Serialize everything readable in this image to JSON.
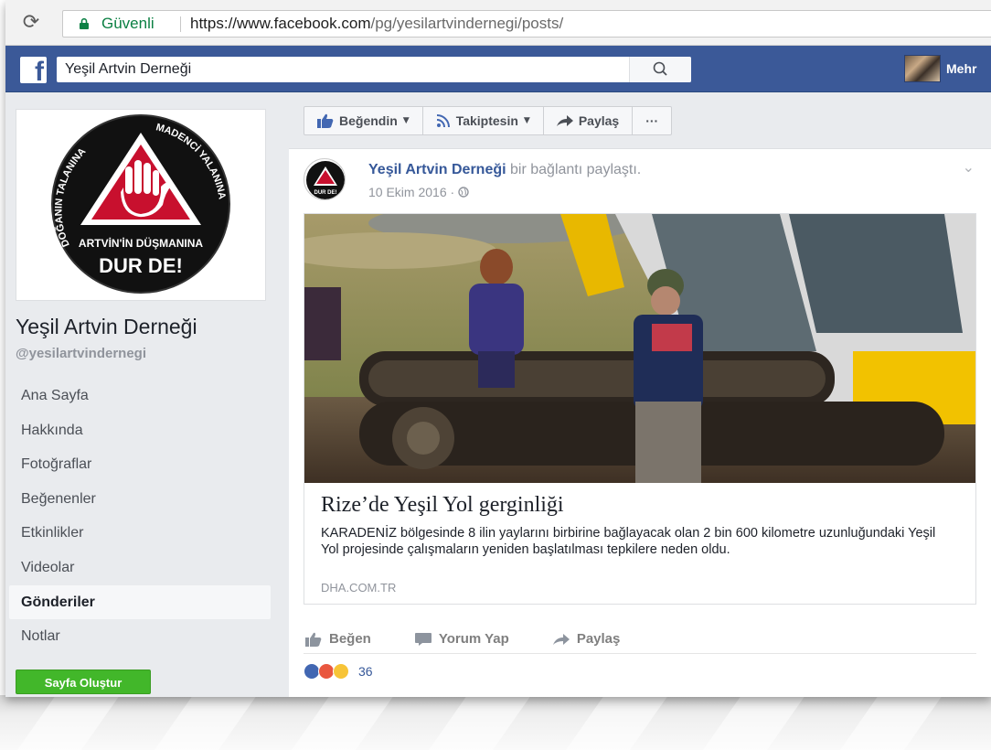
{
  "browser": {
    "secure_label": "Güvenli",
    "url_host": "https://www.facebook.com",
    "url_path": "/pg/yesilartvindernegi/posts/"
  },
  "fb_header": {
    "logo": "f",
    "search_value": "Yeşil Artvin Derneği",
    "user_name": "Mehr"
  },
  "page": {
    "logo_text_top_left": "DOĞANIN TALANINA",
    "logo_text_top_right": "MADENCİ YALANINA",
    "logo_text_middle": "ARTVİN'İN DÜŞMANINA",
    "logo_text_bottom": "DUR DE!",
    "name": "Yeşil Artvin Derneği",
    "handle": "@yesilartvindernegi"
  },
  "nav": {
    "items": [
      {
        "label": "Ana Sayfa"
      },
      {
        "label": "Hakkında"
      },
      {
        "label": "Fotoğraflar"
      },
      {
        "label": "Beğenenler"
      },
      {
        "label": "Etkinlikler"
      },
      {
        "label": "Videolar"
      },
      {
        "label": "Gönderiler"
      },
      {
        "label": "Notlar"
      }
    ],
    "active": "Gönderiler"
  },
  "create_page_label": "Sayfa Oluştur",
  "page_actions": {
    "liked": "Beğendin",
    "following": "Takiptesin",
    "share": "Paylaş",
    "more": "···"
  },
  "post": {
    "author": "Yeşil Artvin Derneği",
    "action": "bir bağlantı paylaştı.",
    "date": "10 Ekim 2016 ·",
    "avatar_text": "DUR DE!",
    "link": {
      "title": "Rize’de Yeşil Yol gerginliği",
      "description": "KARADENİZ bölgesinde 8 ilin yaylarını birbirine bağlayacak olan 2 bin 600 kilometre uzunluğundaki Yeşil Yol projesinde çalışmaların yeniden başlatılması tepkilere neden oldu.",
      "domain": "DHA.COM.TR"
    },
    "actions": {
      "like": "Beğen",
      "comment": "Yorum Yap",
      "share": "Paylaş"
    },
    "reaction_count": "36"
  },
  "colors": {
    "fb_blue": "#3b5998",
    "link_blue": "#365899",
    "green_button": "#42b72a",
    "secure_green": "#0b8043"
  }
}
